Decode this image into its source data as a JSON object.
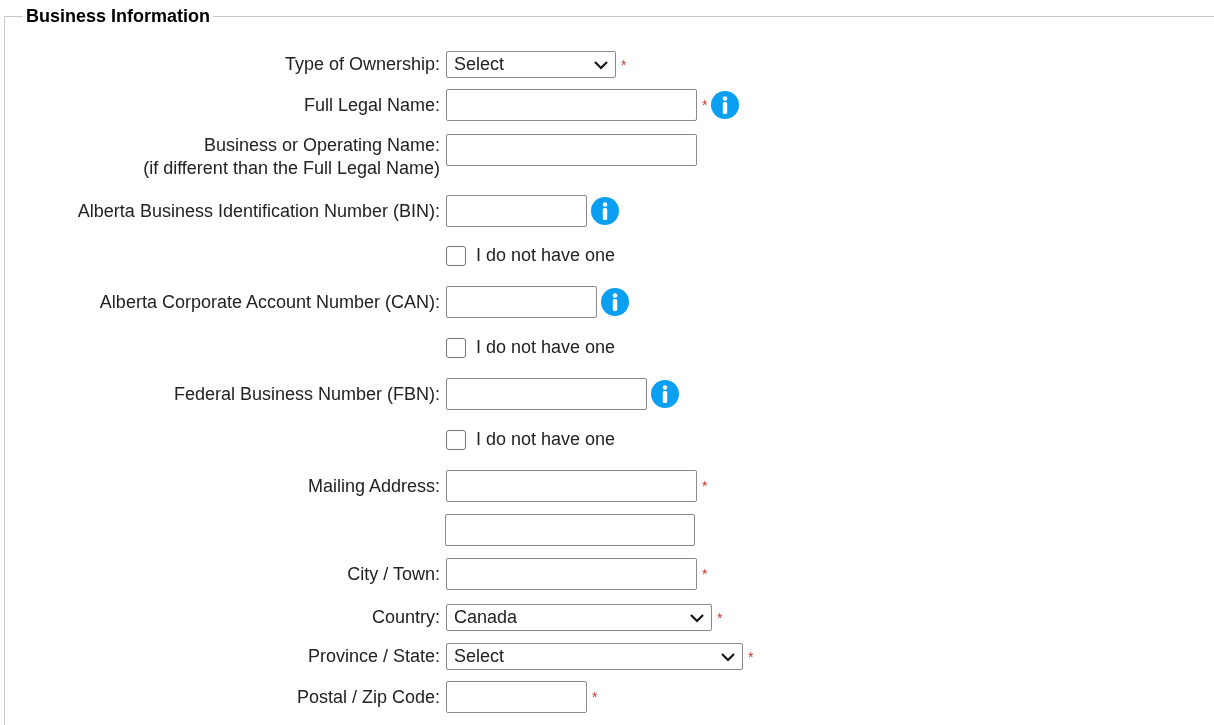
{
  "section": {
    "title": "Business Information"
  },
  "rows": [
    {
      "kind": "select",
      "label": "Type of Ownership:",
      "value": "Select",
      "required_mark": "*"
    },
    {
      "kind": "text",
      "label": "Full Legal Name:",
      "required_mark": "*",
      "info": true
    },
    {
      "kind": "text",
      "label": "Business or Operating Name:",
      "note": "(if different than the Full Legal Name)"
    },
    {
      "kind": "text",
      "label": "Alberta Business Identification Number (BIN):",
      "info": true
    },
    {
      "kind": "checkbox",
      "label": "I do not have one",
      "checked": false
    },
    {
      "kind": "text",
      "label": "Alberta Corporate Account Number (CAN):",
      "info": true
    },
    {
      "kind": "checkbox",
      "label": "I do not have one",
      "checked": false
    },
    {
      "kind": "text",
      "label": "Federal Business Number (FBN):",
      "info": true
    },
    {
      "kind": "checkbox",
      "label": "I do not have one",
      "checked": false
    },
    {
      "kind": "text",
      "label": "Mailing Address:",
      "required_mark": "*"
    },
    {
      "kind": "text"
    },
    {
      "kind": "text",
      "label": "City / Town:",
      "required_mark": "*"
    },
    {
      "kind": "select",
      "label": "Country:",
      "value": "Canada",
      "required_mark": "*"
    },
    {
      "kind": "select",
      "label": "Province / State:",
      "value": "Select",
      "required_mark": "*"
    },
    {
      "kind": "text",
      "label": "Postal / Zip Code:",
      "required_mark": "*"
    }
  ]
}
